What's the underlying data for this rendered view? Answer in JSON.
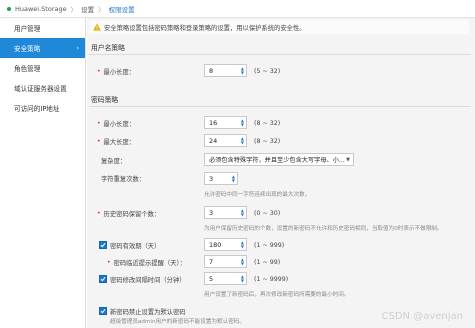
{
  "breadcrumb": {
    "app": "Huawei.Storage",
    "level1": "设置",
    "level2": "权限设置",
    "separator": "〉"
  },
  "sidebar": {
    "items": [
      {
        "label": "用户管理"
      },
      {
        "label": "安全策略",
        "chevron": "›"
      },
      {
        "label": "角色管理"
      },
      {
        "label": "域认证服务器设置"
      },
      {
        "label": "可访问的IP地址"
      }
    ]
  },
  "notice": {
    "text": "安全策略设置包括密码策略和登录策略的设置，用以保护系统的安全性。"
  },
  "username_policy": {
    "title": "用户名策略",
    "min_length": {
      "label": "最小长度：",
      "value": "8",
      "range": "(5 ~ 32)"
    }
  },
  "password_policy": {
    "title": "密码策略",
    "min_length": {
      "label": "最小长度：",
      "value": "16",
      "range": "(8 ~ 32)"
    },
    "max_length": {
      "label": "最大长度：",
      "value": "24",
      "range": "(8 ~ 32)"
    },
    "complexity": {
      "label": "复杂度：",
      "value": "必须包含特殊字符，并且至少包含大写字母、小..."
    },
    "repeat": {
      "label": "字符重复次数：",
      "value": "3",
      "hint": "允许密码中同一字符连续出现的最大次数。"
    },
    "history": {
      "label": "历史密码保留个数：",
      "value": "3",
      "range": "(0 ~ 30)",
      "hint": "为用户保留历史密码的个数，设置的新密码不允许和历史密码相同，当取值为0时表示不做限制。"
    },
    "validity": {
      "label": "密码有效期（天）",
      "value": "180",
      "range": "(1 ~ 999)"
    },
    "warning": {
      "label": "密码临近提示提醒（天）：",
      "value": "7",
      "range": "(1 ~ 99)"
    },
    "interval": {
      "label": "密码修改间隔时间（分钟）",
      "value": "5",
      "range": "(1 ~ 9999)",
      "hint": "用户设置了新密码后，再次修改新密码所需要的最小时间。"
    },
    "forbid_default": {
      "label": "新密码禁止设置为默认密码",
      "hint": "超级管理员admin用户的新密码不能设置为默认密码。"
    }
  },
  "watermark": "CSDN @avenjan",
  "colors": {
    "accent": "#1f88d8",
    "required": "#e1251b"
  }
}
